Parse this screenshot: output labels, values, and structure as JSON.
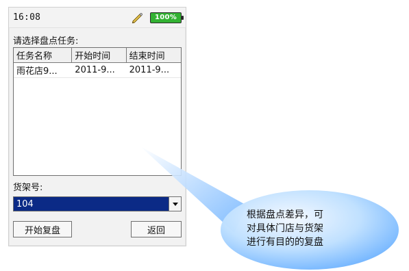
{
  "status": {
    "time": "16:08",
    "battery_text": "100%"
  },
  "screen": {
    "prompt": "请选择盘点任务:",
    "table": {
      "headers": [
        "任务名称",
        "开始时间",
        "结束时间"
      ],
      "rows": [
        [
          "雨花店9...",
          "2011-9...",
          "2011-9..."
        ]
      ]
    },
    "shelf": {
      "label": "货架号:",
      "selected_value": "104"
    },
    "buttons": {
      "start_label": "开始复盘",
      "back_label": "返回"
    }
  },
  "callout": {
    "text": "根据盘点差异，可\n对具体门店与货架\n进行有目的的复盘"
  },
  "colors": {
    "battery_green": "#33b233",
    "select_highlight": "#0b2a86",
    "callout_blue_light": "#eaf3ff",
    "callout_blue_dark": "#6fb3ff"
  },
  "icons": {
    "pencil": "pencil-icon",
    "dropdown": "chevron-down-icon"
  }
}
